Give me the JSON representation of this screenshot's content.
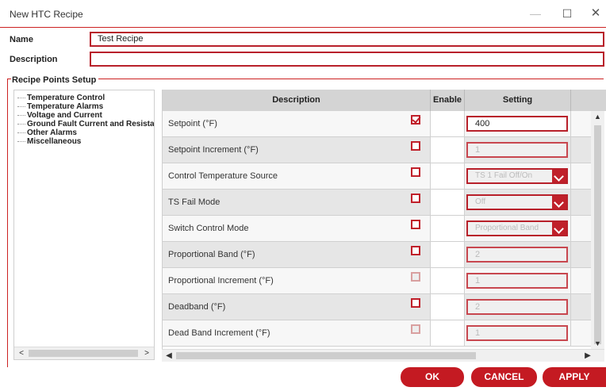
{
  "window": {
    "title": "New HTC Recipe",
    "minimize_glyph": "—",
    "maximize_glyph": "☐",
    "close_glyph": "✕"
  },
  "form": {
    "name_label": "Name",
    "name_value": "Test Recipe",
    "description_label": "Description",
    "description_value": ""
  },
  "group": {
    "title": "Recipe Points Setup"
  },
  "tree": {
    "items": [
      "Temperature Control",
      "Temperature Alarms",
      "Voltage and Current",
      "Ground Fault Current and Resistanc",
      "Other Alarms",
      "Miscellaneous"
    ],
    "scroll_left": "<",
    "scroll_right": ">"
  },
  "grid": {
    "columns": [
      "Description",
      "Enable",
      "Setting"
    ],
    "rows": [
      {
        "description": "Setpoint (°F)",
        "enabled": true,
        "setting": "400",
        "type": "input",
        "active": true
      },
      {
        "description": "Setpoint Increment (°F)",
        "enabled": false,
        "setting": "1",
        "type": "input",
        "active": false
      },
      {
        "description": "Control Temperature Source",
        "enabled": false,
        "setting": "TS 1 Fail Off/On",
        "type": "dropdown",
        "active": false
      },
      {
        "description": "TS Fail Mode",
        "enabled": false,
        "setting": "Off",
        "type": "dropdown",
        "active": false
      },
      {
        "description": "Switch Control Mode",
        "enabled": false,
        "setting": "Proportional Band",
        "type": "dropdown",
        "active": false
      },
      {
        "description": "Proportional Band (°F)",
        "enabled": false,
        "setting": "2",
        "type": "input",
        "active": false
      },
      {
        "description": "Proportional Increment (°F)",
        "enabled": false,
        "setting": "1",
        "type": "input",
        "active": false,
        "checkbox_disabled": true
      },
      {
        "description": "Deadband (°F)",
        "enabled": false,
        "setting": "2",
        "type": "input",
        "active": false
      },
      {
        "description": "Dead Band Increment (°F)",
        "enabled": false,
        "setting": "1",
        "type": "input",
        "active": false,
        "checkbox_disabled": true
      }
    ],
    "scroll_up": "▲",
    "scroll_down": "▼",
    "scroll_left": "◀",
    "scroll_right": "▶"
  },
  "buttons": {
    "ok": "OK",
    "cancel": "CANCEL",
    "apply": "APPLY"
  },
  "colors": {
    "accent": "#c41a22",
    "header_bg": "#d4d4d4",
    "row_alt": "#e6e6e6"
  }
}
